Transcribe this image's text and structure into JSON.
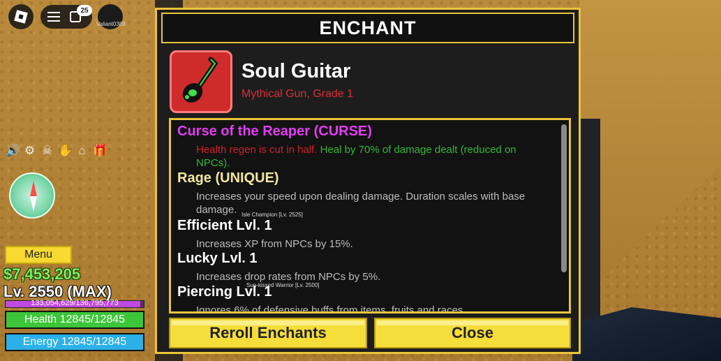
{
  "hud": {
    "notification_count": "25",
    "username": "Valiant0389",
    "menu_label": "Menu",
    "money": "$7,453,205",
    "level": "Lv. 2550 (MAX)",
    "xp": "133,054,629/136,795,773",
    "xp_fraction": 0.973,
    "health": "Health 12845/12845",
    "energy": "Energy 12845/12845",
    "side_icons": [
      "speaker-icon",
      "gear-icon",
      "pirate-flag-icon",
      "hands-icon",
      "home-icon",
      "gift-icon"
    ]
  },
  "enchant": {
    "title": "ENCHANT",
    "item_name": "Soul Guitar",
    "item_subtitle": "Mythical Gun, Grade 1",
    "entries": [
      {
        "title": "Curse of the Reaper (CURSE)",
        "desc_red": "Health regen is cut in half.",
        "desc_green": "Heal by 70% of damage dealt (reduced on NPCs)."
      },
      {
        "title": "Rage (UNIQUE)",
        "desc": "Increases your speed upon dealing damage. Duration scales with base damage."
      },
      {
        "title": "Efficient Lvl. 1",
        "desc": "Increases XP from NPCs by 15%."
      },
      {
        "title": "Lucky Lvl. 1",
        "desc": "Increases drop rates from NPCs by 5%."
      },
      {
        "title": "Piercing Lvl. 1",
        "desc": "Ignores 6% of defensive buffs from items, fruits and races."
      }
    ],
    "npc_labels": [
      "Isle Champion [Lv. 2525]",
      "Sun-kissed Warrior [Lv. 2500]"
    ],
    "reroll_label": "Reroll Enchants",
    "close_label": "Close"
  },
  "colors": {
    "panel_border": "#e9c43b",
    "curse": "#e43cf5",
    "unique": "#f3e5a3",
    "rarity": "#d9303a",
    "money": "#7df05a",
    "health": "#3dc63a",
    "energy": "#2bb0e8"
  }
}
